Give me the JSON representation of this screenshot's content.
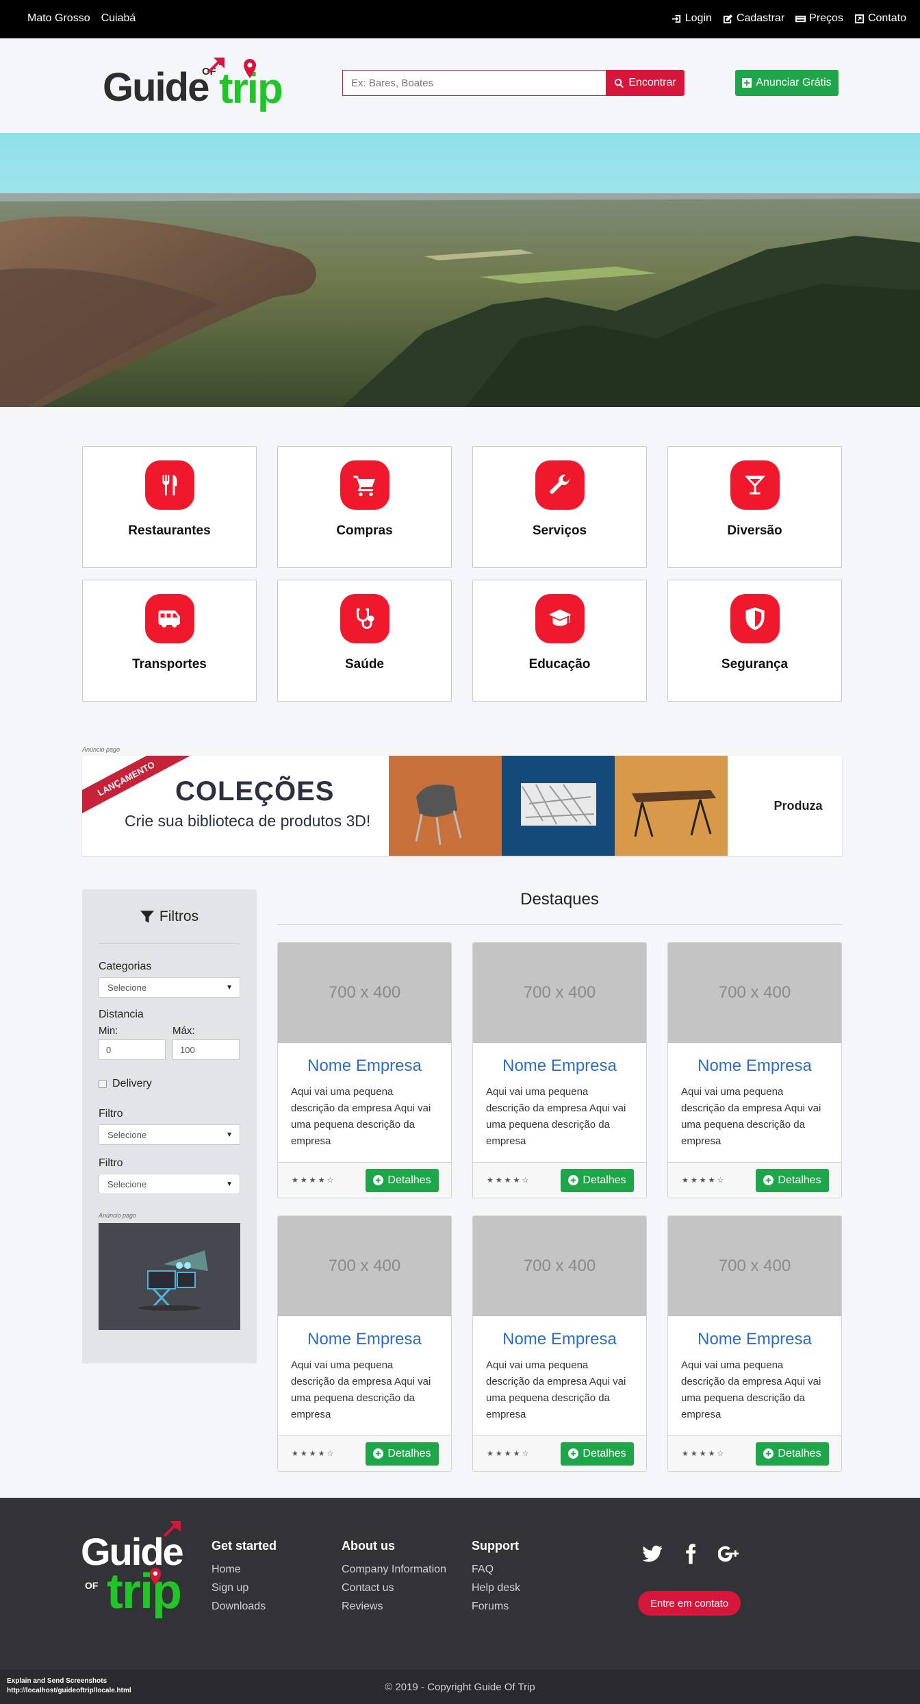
{
  "topbar": {
    "state": "Mato Grosso",
    "city": "Cuiabá",
    "links": [
      {
        "label": "Login",
        "icon": "sign-in-icon"
      },
      {
        "label": "Cadastrar",
        "icon": "edit-icon"
      },
      {
        "label": "Preços",
        "icon": "credit-card-icon"
      },
      {
        "label": "Contato",
        "icon": "external-link-icon"
      }
    ]
  },
  "header": {
    "logo": {
      "guide": "Guide",
      "of": "OF",
      "trip": "trip"
    },
    "search_placeholder": "Ex: Bares, Boates",
    "search_button": "Encontrar",
    "anunciar_button": "Anunciar Grátis"
  },
  "categories": [
    {
      "label": "Restaurantes",
      "icon": "cutlery-icon"
    },
    {
      "label": "Compras",
      "icon": "shopping-cart-icon"
    },
    {
      "label": "Serviços",
      "icon": "wrench-icon"
    },
    {
      "label": "Diversão",
      "icon": "cocktail-icon"
    },
    {
      "label": "Transportes",
      "icon": "van-icon"
    },
    {
      "label": "Saúde",
      "icon": "stethoscope-icon"
    },
    {
      "label": "Educação",
      "icon": "graduation-cap-icon"
    },
    {
      "label": "Segurança",
      "icon": "shield-icon"
    }
  ],
  "ad": {
    "label": "Anúncio pago",
    "ribbon": "LANÇAMENTO",
    "title": "COLEÇÕES",
    "subtitle": "Crie sua biblioteca de produtos 3D!",
    "right_text": "Produza"
  },
  "filters": {
    "title": "Filtros",
    "categorias_label": "Categorias",
    "categorias_value": "Selecione",
    "distancia_label": "Distancia",
    "min_label": "Min:",
    "min_value": "0",
    "max_label": "Máx:",
    "max_value": "100",
    "delivery_label": "Delivery",
    "filtro1_label": "Filtro",
    "filtro1_value": "Selecione",
    "filtro2_label": "Filtro",
    "filtro2_value": "Selecione",
    "ad_label": "Anúncio pago"
  },
  "destaques": {
    "title": "Destaques",
    "cards": [
      {
        "image": "700 x 400",
        "name": "Nome Empresa",
        "desc": "Aqui vai uma pequena descrição da empresa Aqui vai uma pequena descrição da empresa",
        "stars": "★★★★☆",
        "button": "Detalhes"
      },
      {
        "image": "700 x 400",
        "name": "Nome Empresa",
        "desc": "Aqui vai uma pequena descrição da empresa Aqui vai uma pequena descrição da empresa",
        "stars": "★★★★☆",
        "button": "Detalhes"
      },
      {
        "image": "700 x 400",
        "name": "Nome Empresa",
        "desc": "Aqui vai uma pequena descrição da empresa Aqui vai uma pequena descrição da empresa",
        "stars": "★★★★☆",
        "button": "Detalhes"
      },
      {
        "image": "700 x 400",
        "name": "Nome Empresa",
        "desc": "Aqui vai uma pequena descrição da empresa Aqui vai uma pequena descrição da empresa",
        "stars": "★★★★☆",
        "button": "Detalhes"
      },
      {
        "image": "700 x 400",
        "name": "Nome Empresa",
        "desc": "Aqui vai uma pequena descrição da empresa Aqui vai uma pequena descrição da empresa",
        "stars": "★★★★☆",
        "button": "Detalhes"
      },
      {
        "image": "700 x 400",
        "name": "Nome Empresa",
        "desc": "Aqui vai uma pequena descrição da empresa Aqui vai uma pequena descrição da empresa",
        "stars": "★★★★☆",
        "button": "Detalhes"
      }
    ]
  },
  "footer": {
    "columns": [
      {
        "title": "Get started",
        "links": [
          "Home",
          "Sign up",
          "Downloads"
        ]
      },
      {
        "title": "About us",
        "links": [
          "Company Information",
          "Contact us",
          "Reviews"
        ]
      },
      {
        "title": "Support",
        "links": [
          "FAQ",
          "Help desk",
          "Forums"
        ]
      }
    ],
    "social": [
      "twitter-icon",
      "facebook-icon",
      "google-plus-icon"
    ],
    "contact_button": "Entre em contato",
    "copyright": "© 2019 - Copyright Guide Of Trip",
    "debug_line1": "Explain and Send Screenshots",
    "debug_line2": "http://localhost/guideoftrip/locale.html"
  },
  "colors": {
    "brand_red": "#d6163a",
    "category_red": "#f0182c",
    "green": "#1fa64a",
    "logo_green": "#22c528",
    "link_blue": "#2f6eba"
  }
}
